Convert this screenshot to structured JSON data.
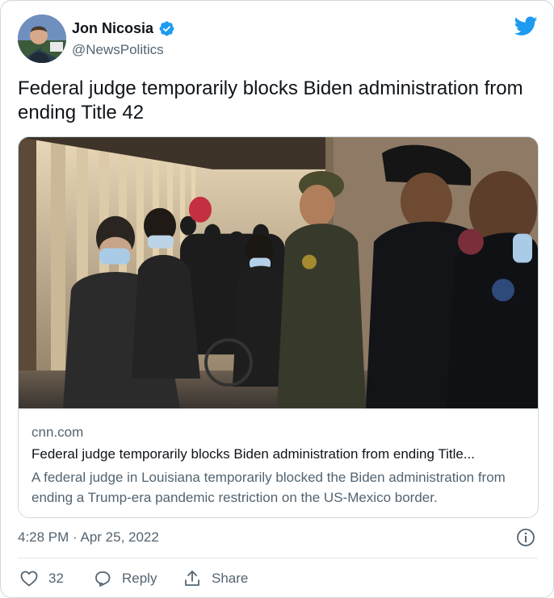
{
  "author": {
    "name": "Jon Nicosia",
    "handle": "@NewsPolitics",
    "verified": true,
    "avatar_icon": "user-avatar"
  },
  "tweet": {
    "text": "Federal judge temporarily blocks Biden administration from ending Title 42",
    "timestamp": "4:28 PM · Apr 25, 2022"
  },
  "card": {
    "image_description_icon": "photo-migrants-border-bridge",
    "domain": "cnn.com",
    "title": "Federal judge temporarily blocks Biden administration from ending Title...",
    "description": "A federal judge in Louisiana temporarily blocked the Biden administration from ending a Trump-era pandemic restriction on the US-Mexico border."
  },
  "actions": {
    "like_count": "32",
    "reply_label": "Reply",
    "share_label": "Share"
  },
  "colors": {
    "twitter_blue": "#1d9bf0",
    "text_primary": "#0f1419",
    "text_secondary": "#536471",
    "border": "#cfd9de"
  }
}
